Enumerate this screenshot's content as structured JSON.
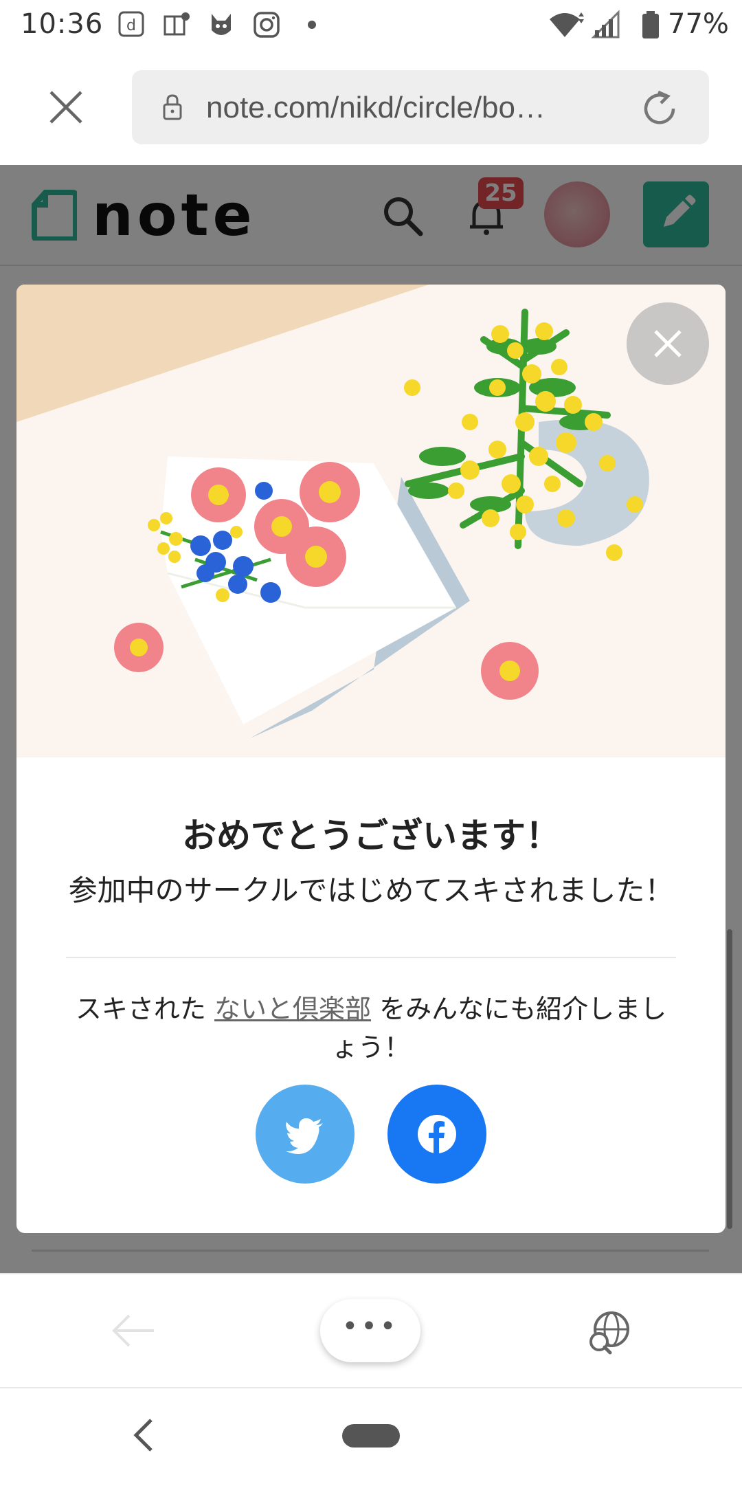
{
  "status_bar": {
    "time": "10:36",
    "battery": "77%",
    "icons": [
      "d-app-icon",
      "news-icon",
      "cat-app-icon",
      "instagram-icon",
      "dot-icon",
      "wifi-icon",
      "signal-icon",
      "battery-icon"
    ]
  },
  "browser": {
    "url": "note.com/nikd/circle/bo…",
    "close_icon": "close-icon",
    "lock_icon": "lock-icon",
    "reload_icon": "reload-icon"
  },
  "note_header": {
    "logo_text": "note",
    "notification_count": "25",
    "brand_color": "#2cb696"
  },
  "modal": {
    "title": "おめでとうございます！",
    "subtitle": "参加中のサークルではじめてスキされました！",
    "share_prefix": "スキされた ",
    "circle_name": "ないと倶楽部",
    "share_suffix": " をみんなにも紹介しましょう！",
    "twitter_color": "#55acee",
    "facebook_color": "#1877f2"
  },
  "bottom_bar": {
    "menu_label": "•••"
  }
}
